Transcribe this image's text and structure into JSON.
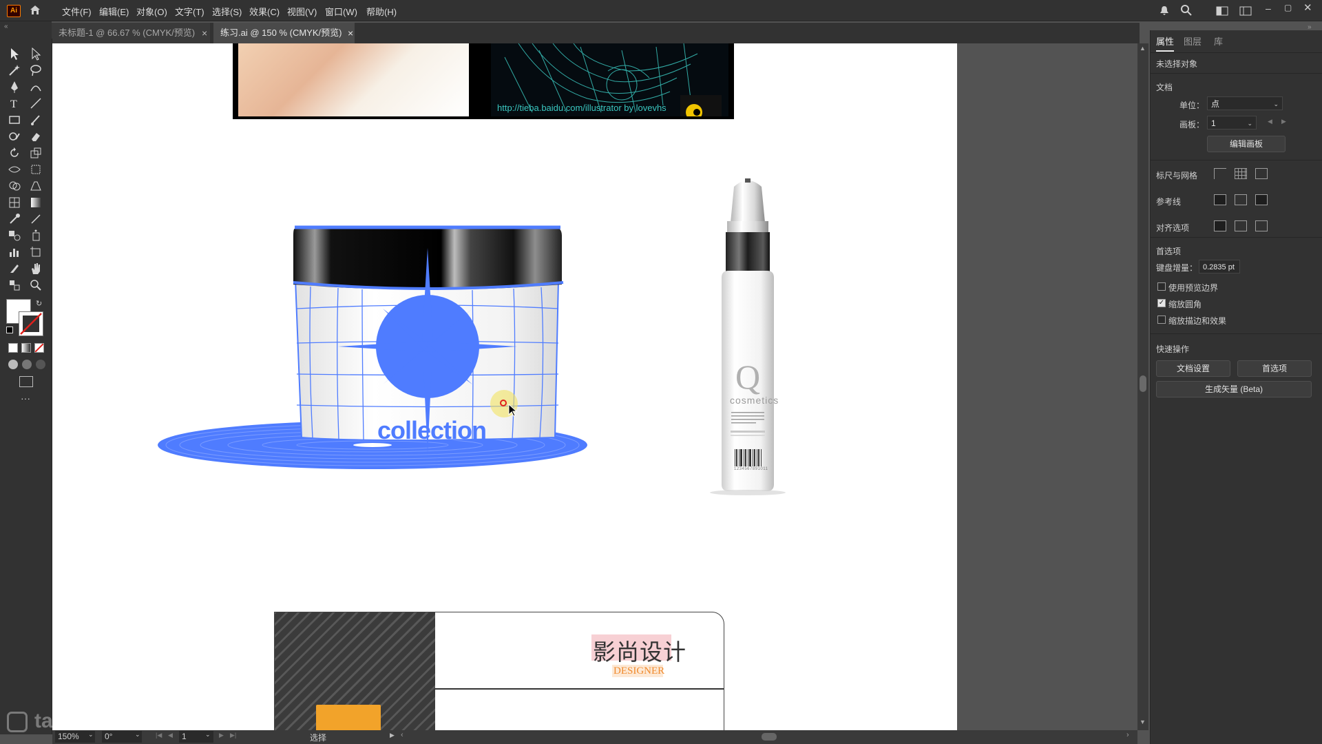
{
  "app": {
    "logo": "Ai"
  },
  "menu": [
    "文件(F)",
    "编辑(E)",
    "对象(O)",
    "文字(T)",
    "选择(S)",
    "效果(C)",
    "视图(V)",
    "窗口(W)",
    "帮助(H)"
  ],
  "tabs": [
    {
      "label": "未标题-1 @ 66.67 % (CMYK/预览)",
      "active": false,
      "close": "×"
    },
    {
      "label": "练习.ai @ 150 % (CMYK/预览)",
      "active": true,
      "close": "×"
    }
  ],
  "artwork": {
    "banner_url": "http://tieba.baidu.com/illustrator by lovevhs",
    "jar_label": "collection",
    "bottle_logo": "Q",
    "bottle_brand": "cosmetics",
    "bottle_barcode_number": "1234567891011",
    "card_title": "影尚设计",
    "card_subtitle": "DESIGNER"
  },
  "panel": {
    "tabs": [
      "属性",
      "图层",
      "库"
    ],
    "no_selection": "未选择对象",
    "doc_section": "文档",
    "unit_label": "单位：",
    "unit_value": "点",
    "artboard_label": "画板：",
    "artboard_value": "1",
    "edit_artboard_btn": "编辑画板",
    "rulers_grid": "标尺与网格",
    "guides": "参考线",
    "snap_options": "对齐选项",
    "prefs": "首选项",
    "key_increment_label": "键盘增量：",
    "key_increment_value": "0.2835 pt",
    "checkboxes": [
      {
        "label": "使用预览边界",
        "checked": false
      },
      {
        "label": "缩放圆角",
        "checked": true
      },
      {
        "label": "缩放描边和效果",
        "checked": false
      }
    ],
    "quick_actions": "快速操作",
    "doc_setup_btn": "文档设置",
    "prefs_btn": "首选项",
    "generate_vector_btn": "生成矢量 (Beta)"
  },
  "status": {
    "zoom": "150%",
    "rotation": "0°",
    "artboard_num": "1",
    "tool": "选择"
  },
  "watermark": "tafe.cc",
  "colors": {
    "accent_blue": "#4f7cff",
    "card_orange": "#f2a32a",
    "title_highlight": "#f7d0d4"
  }
}
